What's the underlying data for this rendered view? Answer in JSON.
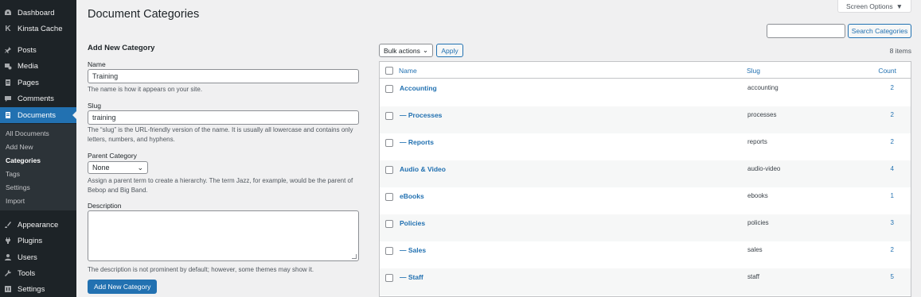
{
  "sidebar": {
    "items": [
      {
        "label": "Dashboard",
        "icon": "dashboard-icon"
      },
      {
        "label": "Kinsta Cache",
        "icon": "kinsta-icon"
      },
      {
        "label": "Posts",
        "icon": "pin-icon"
      },
      {
        "label": "Media",
        "icon": "media-icon"
      },
      {
        "label": "Pages",
        "icon": "pages-icon"
      },
      {
        "label": "Comments",
        "icon": "comments-icon"
      },
      {
        "label": "Documents",
        "icon": "document-icon"
      },
      {
        "label": "Appearance",
        "icon": "brush-icon"
      },
      {
        "label": "Plugins",
        "icon": "plugin-icon"
      },
      {
        "label": "Users",
        "icon": "user-icon"
      },
      {
        "label": "Tools",
        "icon": "wrench-icon"
      },
      {
        "label": "Settings",
        "icon": "settings-icon"
      }
    ],
    "submenu": [
      "All Documents",
      "Add New",
      "Categories",
      "Tags",
      "Settings",
      "Import"
    ]
  },
  "header": {
    "title": "Document Categories",
    "screen_options": "Screen Options"
  },
  "form": {
    "heading": "Add New Category",
    "name_label": "Name",
    "name_value": "Training",
    "name_help": "The name is how it appears on your site.",
    "slug_label": "Slug",
    "slug_value": "training",
    "slug_help": "The “slug” is the URL-friendly version of the name. It is usually all lowercase and contains only letters, numbers, and hyphens.",
    "parent_label": "Parent Category",
    "parent_value": "None",
    "parent_help": "Assign a parent term to create a hierarchy. The term Jazz, for example, would be the parent of Bebop and Big Band.",
    "desc_label": "Description",
    "desc_help": "The description is not prominent by default; however, some themes may show it.",
    "submit": "Add New Category"
  },
  "toolbar": {
    "bulk_actions": "Bulk actions",
    "apply": "Apply",
    "search_button": "Search Categories",
    "items_count": "8 items"
  },
  "table": {
    "columns": {
      "name": "Name",
      "slug": "Slug",
      "count": "Count"
    },
    "rows": [
      {
        "name": "Accounting",
        "slug": "accounting",
        "count": "2"
      },
      {
        "name": "— Processes",
        "slug": "processes",
        "count": "2"
      },
      {
        "name": "— Reports",
        "slug": "reports",
        "count": "2"
      },
      {
        "name": "Audio & Video",
        "slug": "audio-video",
        "count": "4"
      },
      {
        "name": "eBooks",
        "slug": "ebooks",
        "count": "1"
      },
      {
        "name": "Policies",
        "slug": "policies",
        "count": "3"
      },
      {
        "name": "— Sales",
        "slug": "sales",
        "count": "2"
      },
      {
        "name": "— Staff",
        "slug": "staff",
        "count": "5"
      }
    ]
  },
  "colors": {
    "accent": "#2271b1",
    "sidebar_bg": "#1d2327",
    "submenu_bg": "#2c3338",
    "page_bg": "#f0f0f1"
  }
}
